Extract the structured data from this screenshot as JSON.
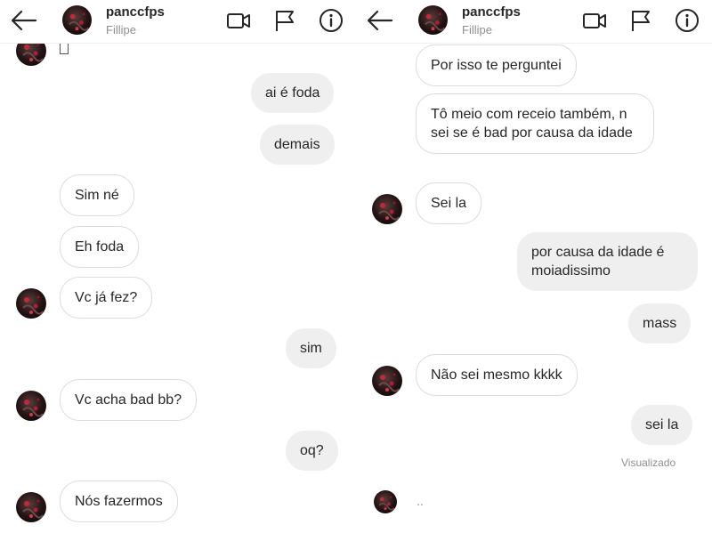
{
  "left": {
    "header": {
      "username": "panccfps",
      "subtitle": "Fillipe"
    },
    "messages": [
      {
        "text": "ai é foda"
      },
      {
        "text": "demais"
      },
      {
        "text": "Sim né"
      },
      {
        "text": "Eh foda"
      },
      {
        "text": "Vc já fez?"
      },
      {
        "text": "sim"
      },
      {
        "text": "Vc acha bad bb?"
      },
      {
        "text": "oq?"
      },
      {
        "text": "Nós fazermos"
      }
    ]
  },
  "right": {
    "header": {
      "username": "panccfps",
      "subtitle": "Fillipe"
    },
    "messages": [
      {
        "text": "Por isso te perguntei"
      },
      {
        "text": "Tô meio com receio também, n sei se é bad por causa da idade"
      },
      {
        "text": "Sei la"
      },
      {
        "text": "por causa da idade é moiadissimo"
      },
      {
        "text": "mass"
      },
      {
        "text": "Não sei mesmo kkkk"
      },
      {
        "text": "sei la"
      },
      {
        "text": ".."
      }
    ],
    "seen_label": "Visualizado"
  },
  "icons": [
    "back-arrow-icon",
    "video-call-icon",
    "flag-icon",
    "info-icon"
  ],
  "colors": {
    "outgoing_bubble": "#efefef",
    "incoming_border": "#dbdbdb",
    "muted_text": "#8e8e8e"
  }
}
